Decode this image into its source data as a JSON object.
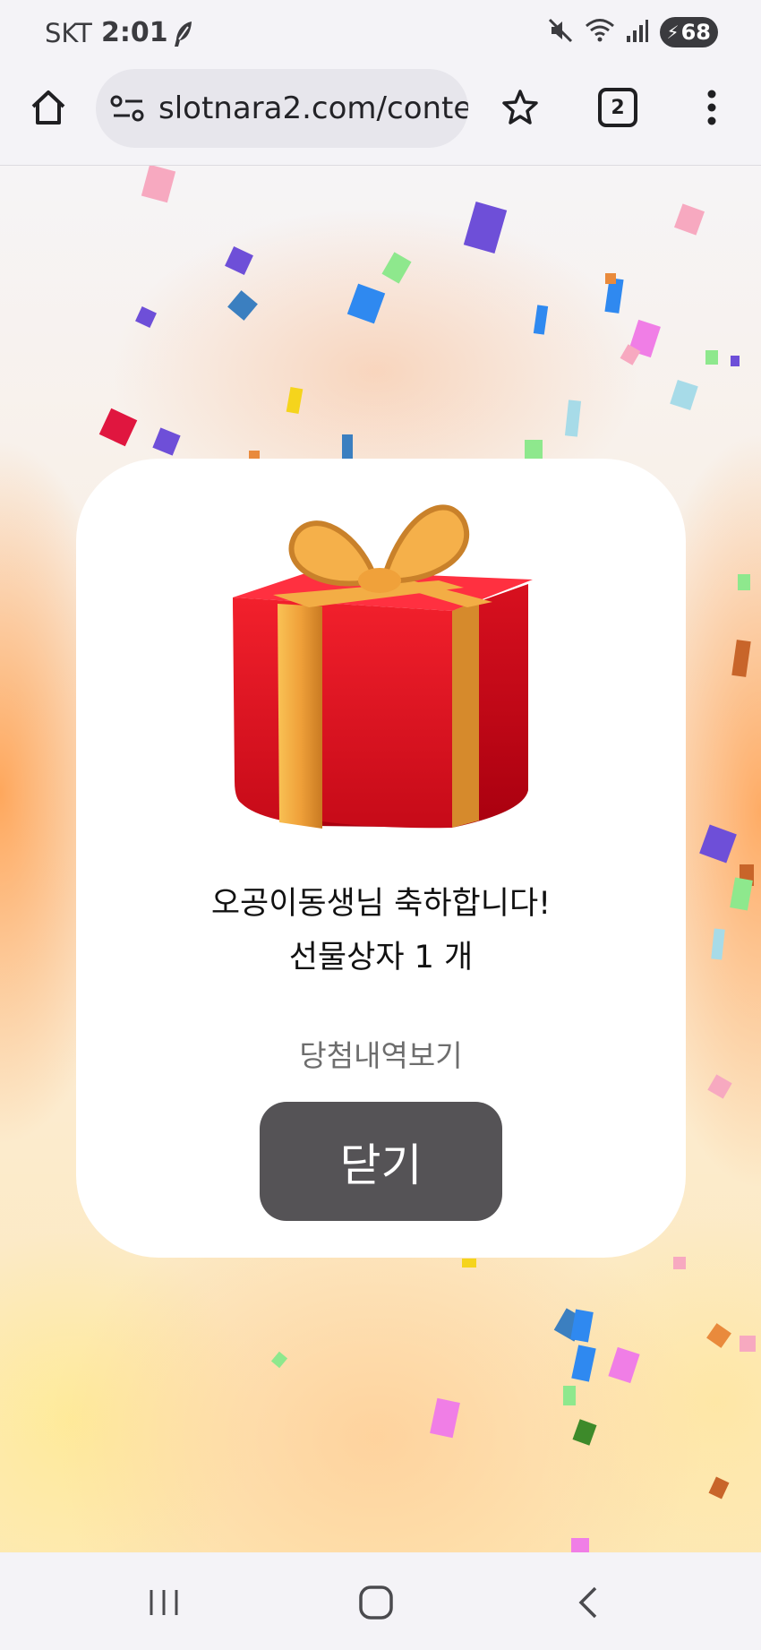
{
  "status_bar": {
    "carrier": "SKT",
    "time": "2:01",
    "battery": "68",
    "icons": [
      "feather-notification-icon",
      "mute-icon",
      "wifi-icon",
      "signal-icon",
      "battery-charging-icon"
    ]
  },
  "browser": {
    "url": "slotnara2.com/conte",
    "tab_count": "2",
    "icons": [
      "home-icon",
      "site-settings-icon",
      "bookmark-star-icon",
      "tabs-icon",
      "more-menu-icon"
    ]
  },
  "popup": {
    "image": "gift-box-icon",
    "congrats": "오공이동생님 축하합니다!",
    "prize": "선물상자 1 개",
    "history_link": "당첨내역보기",
    "close_button": "닫기"
  },
  "nav_bar": {
    "icons": [
      "recent-apps-icon",
      "home-nav-icon",
      "back-icon"
    ]
  },
  "colors": {
    "close_button": "#555356",
    "gift_red": "#e0101f",
    "ribbon_gold": "#f0a93c"
  }
}
